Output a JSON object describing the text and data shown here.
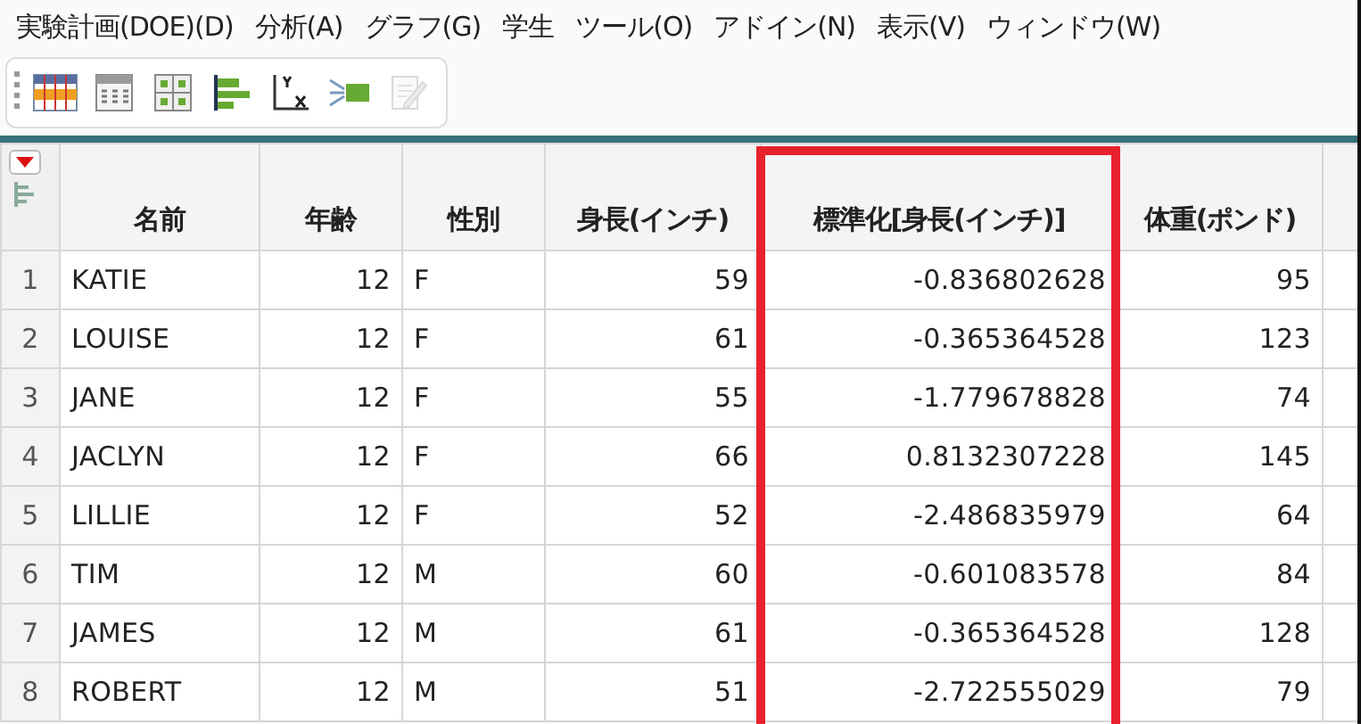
{
  "menu": [
    "実験計画(DOE)(D)",
    "分析(A)",
    "グラフ(G)",
    "学生",
    "ツール(O)",
    "アドイン(N)",
    "表示(V)",
    "ウィンドウ(W)"
  ],
  "toolbar": [
    {
      "kind": "data-table",
      "disabled": false
    },
    {
      "kind": "column-info",
      "disabled": false
    },
    {
      "kind": "grid",
      "disabled": false
    },
    {
      "kind": "bars",
      "disabled": false
    },
    {
      "kind": "yx",
      "disabled": false
    },
    {
      "kind": "funnel",
      "disabled": false
    },
    {
      "kind": "edit",
      "disabled": true
    }
  ],
  "table": {
    "columns": [
      {
        "label": "名前",
        "kind": "text",
        "highlighted": false
      },
      {
        "label": "年齢",
        "kind": "number",
        "highlighted": false
      },
      {
        "label": "性別",
        "kind": "text",
        "highlighted": false
      },
      {
        "label": "身長(インチ)",
        "kind": "number",
        "highlighted": false
      },
      {
        "label": "標準化[身長(インチ)]",
        "kind": "number",
        "highlighted": true
      },
      {
        "label": "体重(ポンド)",
        "kind": "number",
        "highlighted": false
      }
    ],
    "rows": [
      {
        "number": "1",
        "cells": [
          "KATIE",
          "12",
          "F",
          "59",
          "-0.836802628",
          "95"
        ]
      },
      {
        "number": "2",
        "cells": [
          "LOUISE",
          "12",
          "F",
          "61",
          "-0.365364528",
          "123"
        ]
      },
      {
        "number": "3",
        "cells": [
          "JANE",
          "12",
          "F",
          "55",
          "-1.779678828",
          "74"
        ]
      },
      {
        "number": "4",
        "cells": [
          "JACLYN",
          "12",
          "F",
          "66",
          "0.8132307228",
          "145"
        ]
      },
      {
        "number": "5",
        "cells": [
          "LILLIE",
          "12",
          "F",
          "52",
          "-2.486835979",
          "64"
        ]
      },
      {
        "number": "6",
        "cells": [
          "TIM",
          "12",
          "M",
          "60",
          "-0.601083578",
          "84"
        ]
      },
      {
        "number": "7",
        "cells": [
          "JAMES",
          "12",
          "M",
          "61",
          "-0.365364528",
          "128"
        ]
      },
      {
        "number": "8",
        "cells": [
          "ROBERT",
          "12",
          "M",
          "51",
          "-2.722555029",
          "79"
        ]
      }
    ]
  }
}
